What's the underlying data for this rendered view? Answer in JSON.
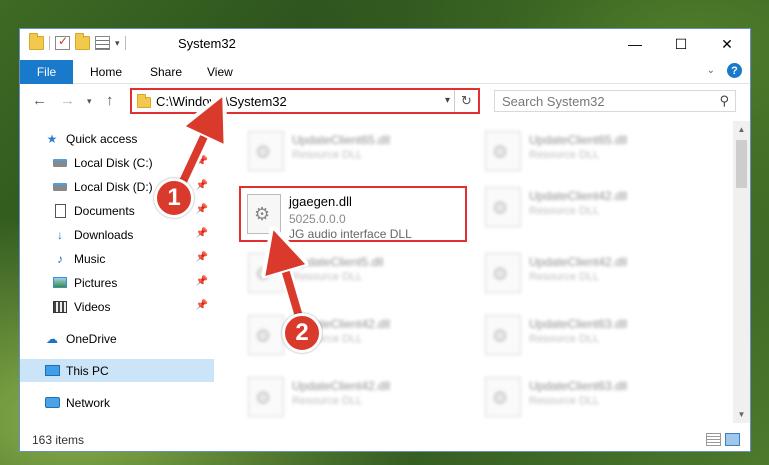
{
  "window": {
    "title": "System32",
    "controls": [
      "—",
      "☐",
      "✕"
    ]
  },
  "ribbon": {
    "tabs": [
      "File",
      "Home",
      "Share",
      "View"
    ],
    "help": "?"
  },
  "navbar": {
    "address": "C:\\Windows\\System32",
    "search_placeholder": "Search System32"
  },
  "sidebar": {
    "items": [
      {
        "label": "Quick access",
        "icon": "star-icon"
      },
      {
        "label": "Local Disk (C:)",
        "icon": "drive-icon",
        "pinned": true
      },
      {
        "label": "Local Disk (D:)",
        "icon": "drive-icon",
        "pinned": true
      },
      {
        "label": "Documents",
        "icon": "documents-icon",
        "pinned": true
      },
      {
        "label": "Downloads",
        "icon": "downloads-icon",
        "pinned": true
      },
      {
        "label": "Music",
        "icon": "music-icon",
        "pinned": true
      },
      {
        "label": "Pictures",
        "icon": "pictures-icon",
        "pinned": true
      },
      {
        "label": "Videos",
        "icon": "videos-icon",
        "pinned": true
      },
      {
        "label": "OneDrive",
        "icon": "onedrive-icon"
      },
      {
        "label": "This PC",
        "icon": "this-pc-icon",
        "selected": true
      },
      {
        "label": "Network",
        "icon": "network-icon"
      }
    ]
  },
  "files": {
    "highlighted": {
      "name": "jgaegen.dll",
      "version": "5025.0.0.0",
      "description": "JG audio interface DLL"
    },
    "background": [
      {
        "name": "UpdateClient65.dll",
        "type": "Resource DLL"
      },
      {
        "name": "UpdateClient65.dll",
        "type": "Resource DLL"
      },
      {
        "name": "UpdateClient42.dll",
        "type": "Resource DLL"
      },
      {
        "name": "UpdateClient5.dll",
        "type": "Resource DLL"
      },
      {
        "name": "UpdateClient42.dll",
        "type": "Resource DLL"
      },
      {
        "name": "UpdateClient42.dll",
        "type": "Resource DLL"
      },
      {
        "name": "UpdateClient63.dll",
        "type": "Resource DLL"
      },
      {
        "name": "UpdateClient42.dll",
        "type": "Resource DLL"
      },
      {
        "name": "UpdateClient63.dll",
        "type": "Resource DLL"
      }
    ]
  },
  "status": {
    "item_count": "163 items"
  },
  "annotations": {
    "marker_1": "1",
    "marker_2": "2",
    "color": "#d93a2b"
  },
  "colors": {
    "accent": "#1979ca",
    "highlight_border": "#e03030",
    "selected_bg": "#cce4f7"
  }
}
